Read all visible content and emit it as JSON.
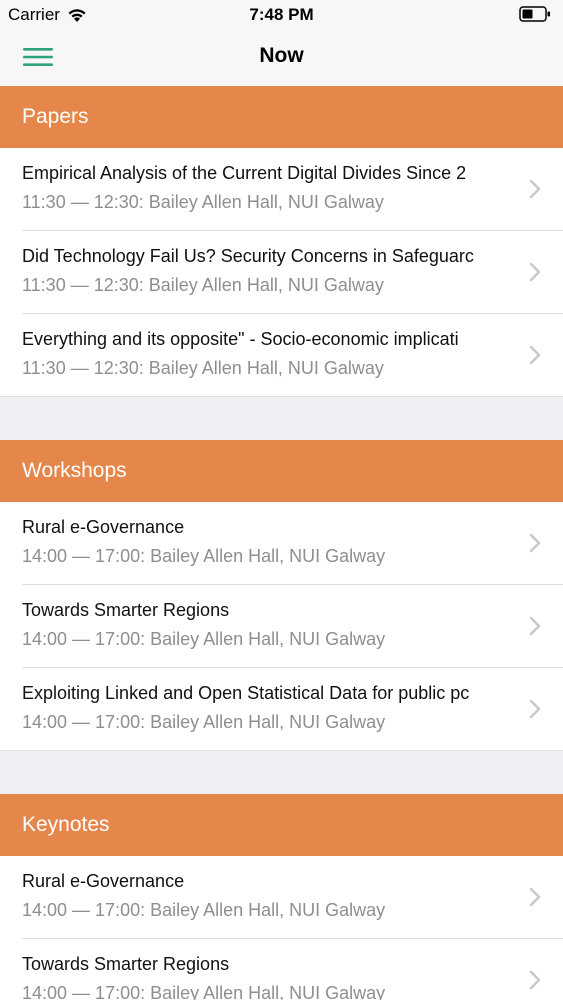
{
  "status_bar": {
    "carrier": "Carrier",
    "time": "7:48 PM",
    "wifi_icon": "wifi-icon",
    "battery_icon": "battery-icon"
  },
  "nav": {
    "title": "Now",
    "menu_icon": "hamburger-menu-icon",
    "accent_color": "#2ea37a"
  },
  "theme": {
    "section_color": "#e5864a"
  },
  "sections": [
    {
      "title": "Papers",
      "items": [
        {
          "title": "Empirical Analysis of the Current Digital Divides Since 2",
          "subtitle": "11:30 — 12:30: Bailey Allen Hall, NUI Galway"
        },
        {
          "title": "Did Technology Fail Us? Security Concerns in Safeguarc",
          "subtitle": "11:30 — 12:30: Bailey Allen Hall, NUI Galway"
        },
        {
          "title": "Everything and its opposite\" - Socio-economic implicati",
          "subtitle": "11:30 — 12:30: Bailey Allen Hall, NUI Galway"
        }
      ]
    },
    {
      "title": "Workshops",
      "items": [
        {
          "title": "Rural e-Governance",
          "subtitle": "14:00 — 17:00: Bailey Allen Hall, NUI Galway"
        },
        {
          "title": "Towards Smarter Regions",
          "subtitle": "14:00 — 17:00: Bailey Allen Hall, NUI Galway"
        },
        {
          "title": "Exploiting Linked and Open Statistical Data for public pc",
          "subtitle": "14:00 — 17:00: Bailey Allen Hall, NUI Galway"
        }
      ]
    },
    {
      "title": "Keynotes",
      "items": [
        {
          "title": "Rural e-Governance",
          "subtitle": "14:00 — 17:00: Bailey Allen Hall, NUI Galway"
        },
        {
          "title": "Towards Smarter Regions",
          "subtitle": "14:00 — 17:00: Bailey Allen Hall, NUI Galway"
        }
      ]
    }
  ]
}
